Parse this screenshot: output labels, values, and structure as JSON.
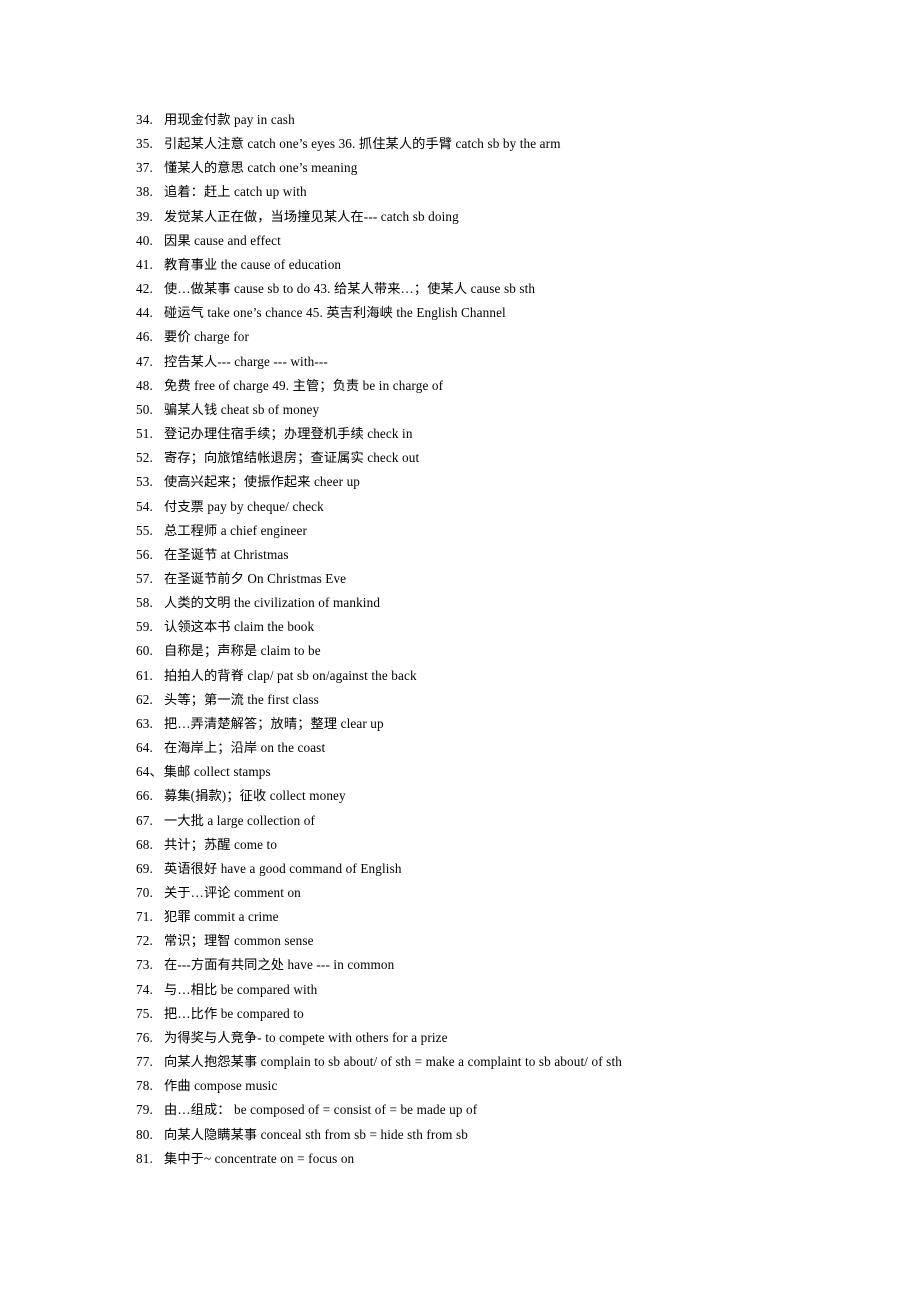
{
  "document": {
    "type": "vocabulary-phrase-list",
    "language_pair": "Chinese-English",
    "background_color": "#ffffff",
    "text_color": "#000000"
  },
  "entries": [
    {
      "number": "34.",
      "text": "用现金付款  pay in cash"
    },
    {
      "number": "35.",
      "text": "引起某人注意  catch one’s eyes 36. 抓住某人的手臂  catch sb by the arm"
    },
    {
      "number": "37.",
      "text": "懂某人的意思  catch one’s meaning"
    },
    {
      "number": "38.",
      "text": "追着：赶上  catch up with"
    },
    {
      "number": "39.",
      "text": "发觉某人正在做，当场撞见某人在--- catch sb doing"
    },
    {
      "number": "40.",
      "text": "因果  cause and effect"
    },
    {
      "number": "41.",
      "text": "教育事业  the cause of education"
    },
    {
      "number": "42.",
      "text": "使…做某事  cause sb to do 43. 给某人带来…；使某人  cause sb sth"
    },
    {
      "number": "44.",
      "text": "碰运气  take one’s chance 45. 英吉利海峡  the English Channel"
    },
    {
      "number": "46.",
      "text": "要价  charge for"
    },
    {
      "number": "47.",
      "text": "控告某人--- charge --- with---"
    },
    {
      "number": "48.",
      "text": "免费  free of charge 49. 主管；负责  be in charge of"
    },
    {
      "number": "50.",
      "text": "骗某人钱  cheat sb of money"
    },
    {
      "number": "51.",
      "text": "登记办理住宿手续；办理登机手续  check in"
    },
    {
      "number": "52.",
      "text": "寄存；向旅馆结帐退房；查证属实  check out"
    },
    {
      "number": "53.",
      "text": "使高兴起来；使振作起来  cheer up"
    },
    {
      "number": "54.",
      "text": "付支票  pay by cheque/ check"
    },
    {
      "number": "55.",
      "text": "总工程师  a chief engineer"
    },
    {
      "number": "56.",
      "text": "在圣诞节  at Christmas"
    },
    {
      "number": "57.",
      "text": "在圣诞节前夕  On Christmas Eve"
    },
    {
      "number": "58.",
      "text": "人类的文明 the civilization of mankind"
    },
    {
      "number": "59.",
      "text": "认领这本书  claim the book"
    },
    {
      "number": "60.",
      "text": "自称是；声称是  claim to be"
    },
    {
      "number": "61.",
      "text": "拍拍人的背脊  clap/ pat sb on/against the back"
    },
    {
      "number": "62.",
      "text": "头等；第一流  the first class"
    },
    {
      "number": "63.",
      "text": "把…弄清楚解答；放晴；整理  clear up"
    },
    {
      "number": "64.",
      "text": "在海岸上；沿岸  on the coast"
    },
    {
      "number": "64、",
      "text": "集邮  collect stamps",
      "compact": true
    },
    {
      "number": "66.",
      "text": "募集(捐款)；征收  collect money"
    },
    {
      "number": "67.",
      "text": "一大批  a large collection of"
    },
    {
      "number": "68.",
      "text": "共计；苏醒  come to"
    },
    {
      "number": "69.",
      "text": "英语很好  have a good command of English"
    },
    {
      "number": "70.",
      "text": "关于…评论  comment on"
    },
    {
      "number": "71.",
      "text": "犯罪  commit a crime"
    },
    {
      "number": "72.",
      "text": "常识；理智  common sense"
    },
    {
      "number": "73.",
      "text": "在---方面有共同之处  have --- in common"
    },
    {
      "number": "74.",
      "text": "与…相比  be compared with"
    },
    {
      "number": "75.",
      "text": "把…比作  be compared to"
    },
    {
      "number": "76.",
      "text": "为得奖与人竞争- to compete with others for a prize"
    },
    {
      "number": "77.",
      "text": "向某人抱怨某事  complain to sb about/ of sth = make a complaint to sb about/ of sth"
    },
    {
      "number": "78.",
      "text": "作曲  compose music"
    },
    {
      "number": "79.",
      "text": "由…组成：   be composed of = consist of = be made up of"
    },
    {
      "number": "80.",
      "text": "向某人隐瞒某事  conceal sth from sb = hide sth from sb"
    },
    {
      "number": "81.",
      "text": "集中于~ concentrate on = focus on"
    }
  ]
}
